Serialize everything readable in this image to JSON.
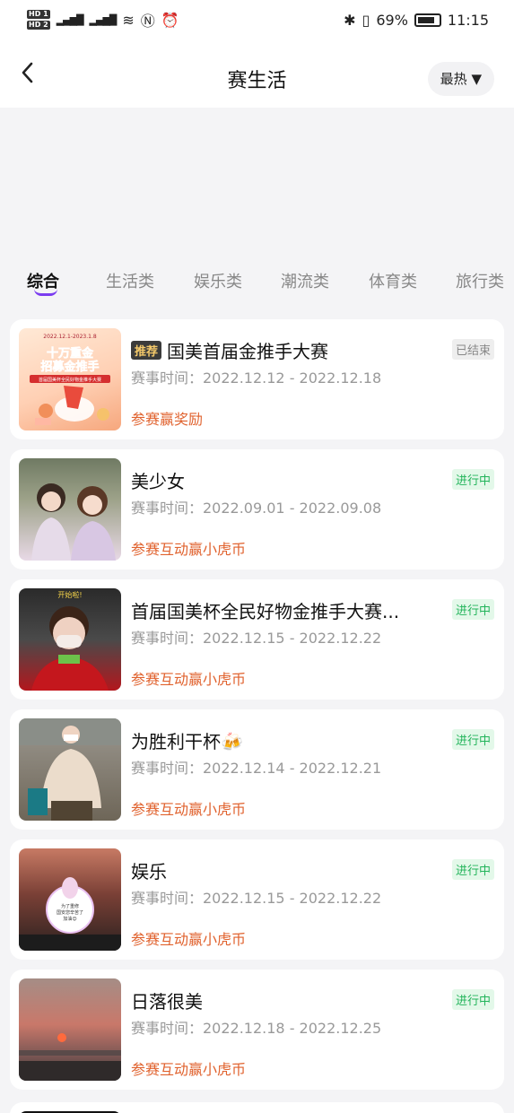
{
  "status_bar": {
    "battery": "69%",
    "time": "11:15",
    "hd1": "HD 1",
    "hd2": "HD 2",
    "net": "4G"
  },
  "nav": {
    "title": "赛生活",
    "sort_label": "最热"
  },
  "tabs": [
    "综合",
    "生活类",
    "娱乐类",
    "潮流类",
    "体育类",
    "旅行类"
  ],
  "active_tab": 0,
  "cards": [
    {
      "badge": "推荐",
      "title": "国美首届金推手大赛",
      "date": "赛事时间：2022.12.12 - 2022.12.18",
      "reward": "参赛赢奖励",
      "status": "已结束",
      "status_type": "ended",
      "thumb_text_top": "2022.12.1-2023.1.8",
      "thumb_text_main": "十万重金 招募金推手",
      "thumb_text_sub": "首届国美杯全民好物金推手大赛"
    },
    {
      "title": "美少女",
      "date": "赛事时间：2022.09.01 - 2022.09.08",
      "reward": "参赛互动赢小虎币",
      "status": "进行中",
      "status_type": "ongoing"
    },
    {
      "title": "首届国美杯全民好物金推手大赛...",
      "date": "赛事时间：2022.12.15 - 2022.12.22",
      "reward": "参赛互动赢小虎币",
      "status": "进行中",
      "status_type": "ongoing",
      "thumb_text_top": "开始啦!"
    },
    {
      "title": "为胜利干杯🍻",
      "date": "赛事时间：2022.12.14 - 2022.12.21",
      "reward": "参赛互动赢小虎币",
      "status": "进行中",
      "status_type": "ongoing"
    },
    {
      "title": "娱乐",
      "date": "赛事时间：2022.12.15 - 2022.12.22",
      "reward": "参赛互动赢小虎币",
      "status": "进行中",
      "status_type": "ongoing",
      "thumb_text_main": "为了重修 国安您辛苦了 加油😊"
    },
    {
      "title": "日落很美",
      "date": "赛事时间：2022.12.18 - 2022.12.25",
      "reward": "参赛互动赢小虎币",
      "status": "进行中",
      "status_type": "ongoing"
    }
  ]
}
